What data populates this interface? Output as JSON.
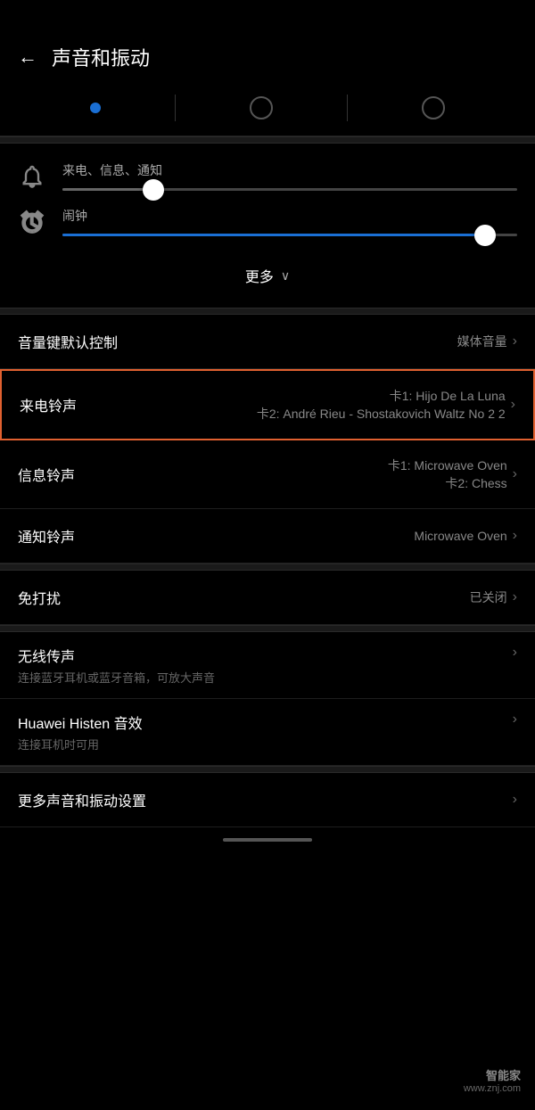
{
  "header": {
    "back_label": "←",
    "title": "声音和振动"
  },
  "tabs": [
    {
      "type": "dot"
    },
    {
      "type": "ring"
    },
    {
      "type": "ring"
    }
  ],
  "volume": {
    "notification_label": "来电、信息、通知",
    "alarm_label": "闹钟",
    "more_label": "更多",
    "notification_fill_pct": 20,
    "alarm_fill_pct": 95
  },
  "settings": [
    {
      "id": "volume-key",
      "label": "音量键默认控制",
      "value_line1": "媒体音量",
      "value_line2": "",
      "highlighted": false
    },
    {
      "id": "ringtone",
      "label": "来电铃声",
      "value_line1": "卡1: Hijo De La Luna",
      "value_line2": "卡2: André Rieu - Shostakovich Waltz No 2 2",
      "highlighted": true
    },
    {
      "id": "message-tone",
      "label": "信息铃声",
      "value_line1": "卡1: Microwave Oven",
      "value_line2": "卡2: Chess",
      "highlighted": false
    },
    {
      "id": "notification-tone",
      "label": "通知铃声",
      "value_line1": "Microwave Oven",
      "value_line2": "",
      "highlighted": false
    }
  ],
  "dnd": {
    "label": "免打扰",
    "value": "已关闭"
  },
  "wireless": {
    "label": "无线传声",
    "subtitle": "连接蓝牙耳机或蓝牙音箱，可放大声音"
  },
  "histen": {
    "label": "Huawei Histen 音效",
    "subtitle": "连接耳机时可用"
  },
  "more_sound": {
    "label": "更多声音和振动设置"
  },
  "watermark": {
    "logo": "智能家",
    "url": "www.znj.com"
  }
}
